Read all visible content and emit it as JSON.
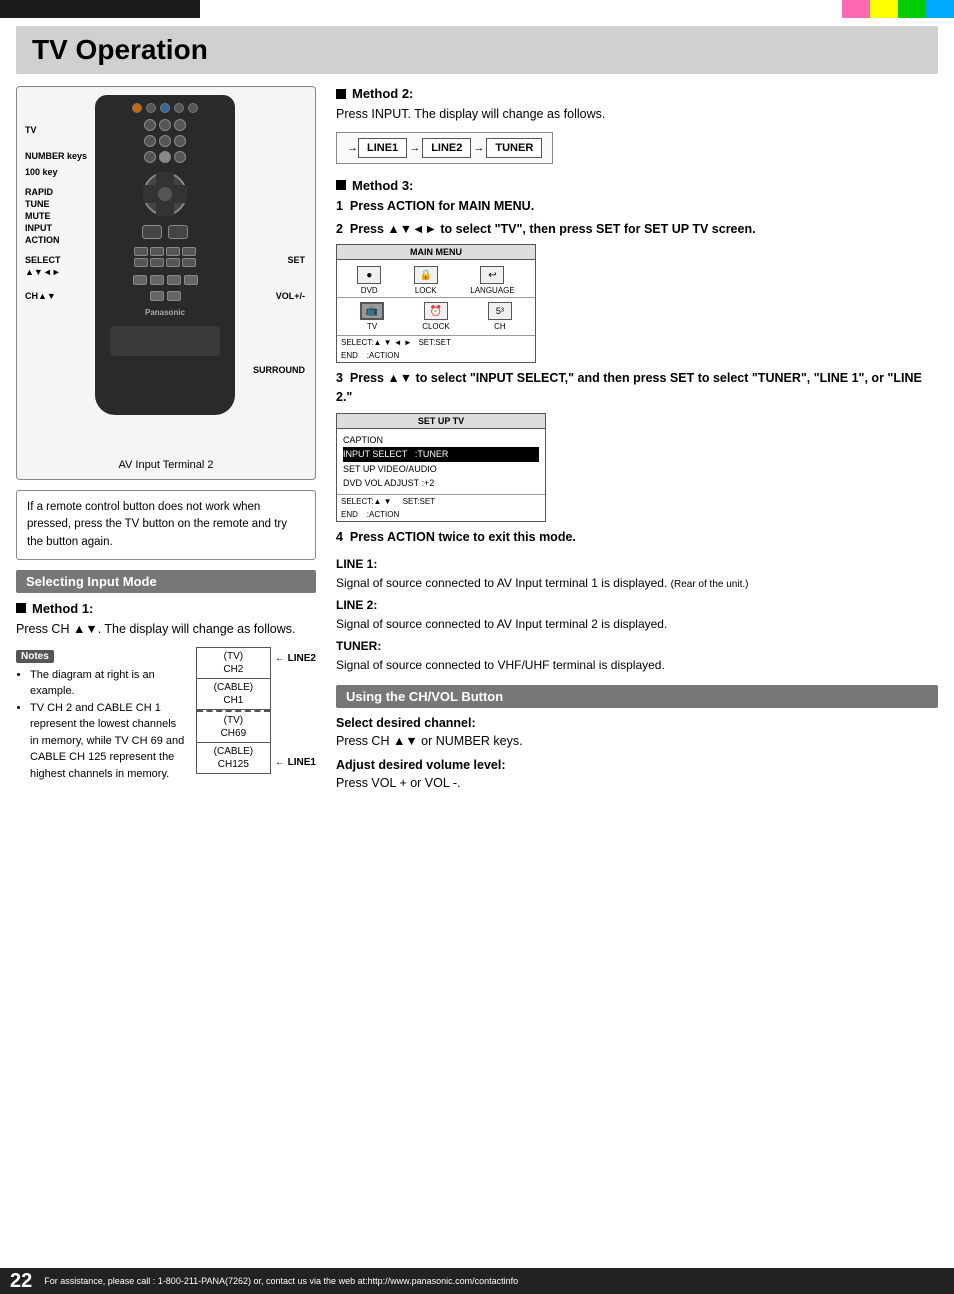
{
  "page": {
    "title": "TV Operation",
    "page_number": "22",
    "footer_text": "For assistance, please call : 1-800-211-PANA(7262) or, contact us via the web at:http://www.panasonic.com/contactinfo"
  },
  "top_colors": [
    "#1a1a1a",
    "#ff69b4",
    "#ffff00",
    "#00cc00",
    "#00aaff"
  ],
  "remote": {
    "labels": {
      "tv": "TV",
      "number_keys": "NUMBER keys",
      "hundred_key": "100 key",
      "rapid": "RAPID",
      "tune": "TUNE",
      "mute": "MUTE",
      "input": "INPUT",
      "action": "ACTION",
      "select": "SELECT",
      "select_arrows": "▲▼◄►",
      "ch_arrows": "CH▲▼",
      "set": "SET",
      "vol": "VOL+/-",
      "surround": "SURROUND"
    },
    "av_label": "AV Input Terminal 2"
  },
  "note_box": {
    "text": "If a remote control button does not work when pressed, press the TV button on the remote and try the button again."
  },
  "selecting_input_mode": {
    "header": "Selecting Input Mode",
    "method1": {
      "heading": "Method 1:",
      "text": "Press CH ▲▼. The display will change as follows."
    },
    "notes_label": "Notes",
    "notes": [
      "The diagram at right is an example.",
      "TV CH 2 and CABLE CH 1 represent the lowest channels in memory, while TV CH 69 and CABLE CH 125 represent the highest channels in memory."
    ],
    "ch_diagram": {
      "rows": [
        {
          "line1": "(TV)",
          "line2": "CH2"
        },
        {
          "line1": "(CABLE)",
          "line2": "CH1"
        },
        {
          "line1": "(TV)",
          "line2": "CH69",
          "dashed": true
        },
        {
          "line1": "(CABLE)",
          "line2": "CH125"
        }
      ],
      "line_labels": [
        "LINE2",
        "LINE1"
      ]
    }
  },
  "method2": {
    "heading": "Method 2:",
    "text": "Press INPUT. The display will change as follows.",
    "diagram": {
      "items": [
        "LINE1",
        "LINE2",
        "TUNER"
      ],
      "arrows": [
        "→",
        "→"
      ]
    }
  },
  "method3": {
    "heading": "Method 3:",
    "steps": [
      {
        "num": "1",
        "text": "Press ACTION for MAIN MENU."
      },
      {
        "num": "2",
        "text": "Press ▲▼◄► to select \"TV\", then press SET for SET UP TV screen."
      }
    ],
    "main_menu": {
      "title": "MAIN MENU",
      "icons": [
        {
          "label": "DVD",
          "icon": "●"
        },
        {
          "label": "LOCK",
          "icon": "🔒"
        },
        {
          "label": "LANGUAGE",
          "icon": "←"
        }
      ],
      "icons2": [
        {
          "label": "TV",
          "icon": "📺"
        },
        {
          "label": "CLOCK",
          "icon": "⏰"
        },
        {
          "label": "CH",
          "icon": "5³"
        }
      ],
      "select_row": "SELECT:▲ ▼ ◄ ►   SET:SET",
      "end_row": "END    :ACTION"
    },
    "step3": {
      "num": "3",
      "text": "Press ▲▼ to select \"INPUT SELECT,\" and then press SET to select \"TUNER\", \"LINE 1\", or \"LINE 2.\""
    },
    "setup_tv": {
      "title": "SET UP TV",
      "lines": [
        "CAPTION",
        "INPUT SELECT   :TUNER",
        "SET UP VIDEO/AUDIO",
        "DVD VOL ADJUST :+2"
      ],
      "highlight_line": "INPUT SELECT   :TUNER",
      "select_row": "SELECT:▲ ▼      SET:SET",
      "end_row": "END    :ACTION"
    },
    "step4": {
      "num": "4",
      "text": "Press ACTION twice to exit this mode."
    }
  },
  "line_explanations": {
    "line1": {
      "label": "LINE 1:",
      "text": "Signal of source connected to AV Input terminal 1 is displayed. (Rear of the unit.)"
    },
    "line2": {
      "label": "LINE 2:",
      "text": "Signal of source connected to AV Input terminal 2 is displayed."
    },
    "tuner": {
      "label": "TUNER:",
      "text": "Signal of source connected to VHF/UHF terminal is displayed."
    }
  },
  "using_ch_vol": {
    "header": "Using the CH/VOL Button",
    "select_channel": {
      "heading": "Select desired channel:",
      "text": "Press CH ▲▼ or NUMBER keys."
    },
    "adjust_volume": {
      "heading": "Adjust desired volume level:",
      "text": "Press VOL + or VOL -."
    }
  }
}
